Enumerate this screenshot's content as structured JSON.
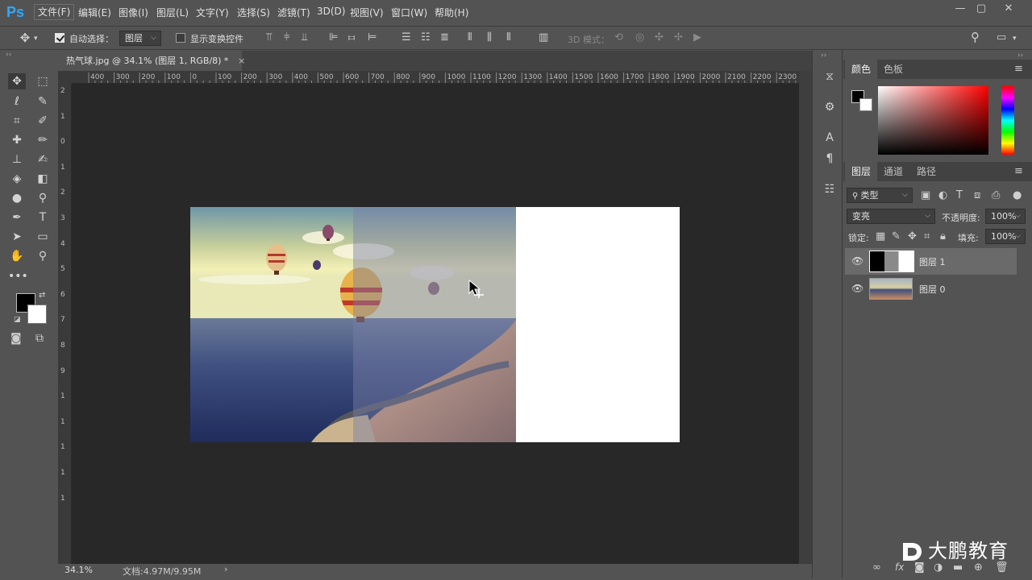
{
  "app": {
    "logo": "Ps"
  },
  "menu": [
    "文件(F)",
    "编辑(E)",
    "图像(I)",
    "图层(L)",
    "文字(Y)",
    "选择(S)",
    "滤镜(T)",
    "3D(D)",
    "视图(V)",
    "窗口(W)",
    "帮助(H)"
  ],
  "window_controls": {
    "minimize": "—",
    "restore": "▢",
    "close": "✕"
  },
  "options": {
    "auto_select_label": "自动选择：",
    "auto_select_checked": true,
    "auto_select_target": "图层",
    "show_transform_label": "显示变换控件",
    "show_transform_checked": false,
    "mode_3d_label": "3D 模式："
  },
  "document": {
    "tab_title": "热气球.jpg @ 34.1% (图层 1, RGB/8) *",
    "close": "×"
  },
  "ruler_h_ticks": [
    "400",
    "300",
    "200",
    "100",
    "0",
    "100",
    "200",
    "300",
    "400",
    "500",
    "600",
    "700",
    "800",
    "900",
    "1000",
    "1100",
    "1200",
    "1300",
    "1400",
    "1500",
    "1600",
    "1700",
    "1800",
    "1900",
    "2000",
    "2100",
    "2200",
    "2300"
  ],
  "ruler_v_ticks": [
    "2",
    "1",
    "0",
    "1",
    "2",
    "3",
    "4",
    "5",
    "6",
    "7",
    "8",
    "9",
    "1",
    "1",
    "1",
    "1",
    "1"
  ],
  "status": {
    "zoom": "34.1%",
    "doc_info": "文档:4.97M/9.95M",
    "arrow": "›"
  },
  "color_panel": {
    "tabs": [
      "颜色",
      "色板"
    ],
    "menu": "≡"
  },
  "layers_panel": {
    "tabs": [
      "图层",
      "通道",
      "路径"
    ],
    "filter_label": "类型",
    "blend_mode": "变亮",
    "opacity_label": "不透明度:",
    "opacity_value": "100%",
    "lock_label": "锁定:",
    "fill_label": "填充:",
    "fill_value": "100%",
    "layers": [
      {
        "name": "图层 1",
        "visible": true,
        "selected": true
      },
      {
        "name": "图层 0",
        "visible": true,
        "selected": false
      }
    ],
    "footer_icons": [
      "link-icon",
      "fx-icon",
      "mask-icon",
      "adjustment-icon",
      "folder-icon",
      "new-layer-icon",
      "trash-icon"
    ],
    "fx_label": "fx"
  },
  "watermark": {
    "brand": "大鹏教育"
  },
  "colors": {
    "accent": "#30a8ff",
    "panel_bg": "#535353",
    "canvas_bg": "#282828"
  }
}
